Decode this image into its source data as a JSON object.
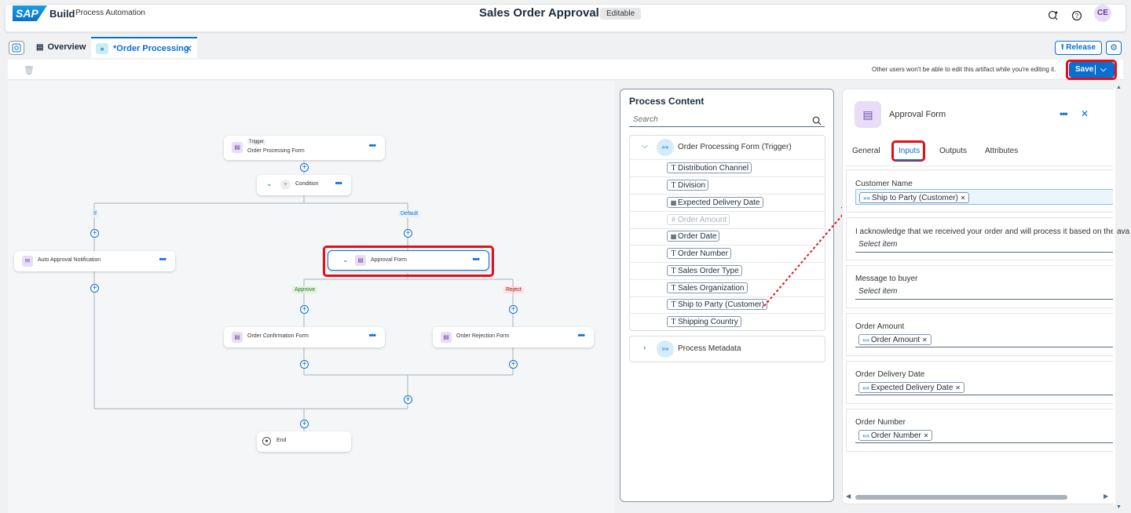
{
  "shell": {
    "logo": "SAP",
    "brand": "Build",
    "product": "Process Automation",
    "title": "Sales Order Approval",
    "status": "Editable",
    "avatar": "CE"
  },
  "tabs": {
    "overview": "Overview",
    "active": "*Order Processing",
    "release": "Release"
  },
  "toolbar": {
    "info": "Other users won't be able to edit this artifact while you're editing it.",
    "save": "Save"
  },
  "flow": {
    "trigger_tag": "Trigger",
    "trigger": "Order Processing Form",
    "condition": "Condition",
    "if_label": "If",
    "default_label": "Default",
    "auto_approval": "Auto Approval Notification",
    "approval_form": "Approval Form",
    "approve_label": "Approve",
    "reject_label": "Reject",
    "confirmation": "Order Confirmation Form",
    "rejection": "Order Rejection Form",
    "end": "End"
  },
  "process_content": {
    "title": "Process Content",
    "search_placeholder": "Search",
    "group1": "Order Processing Form (Trigger)",
    "fields": [
      {
        "label": "Distribution Channel",
        "type": "T"
      },
      {
        "label": "Division",
        "type": "T"
      },
      {
        "label": "Expected Delivery Date",
        "type": "date"
      },
      {
        "label": "Order Amount",
        "type": "#"
      },
      {
        "label": "Order Date",
        "type": "date"
      },
      {
        "label": "Order Number",
        "type": "T"
      },
      {
        "label": "Sales Order Type",
        "type": "T"
      },
      {
        "label": "Sales Organization",
        "type": "T"
      },
      {
        "label": "Ship to Party (Customer)",
        "type": "T"
      },
      {
        "label": "Shipping Country",
        "type": "T"
      }
    ],
    "group2": "Process Metadata"
  },
  "details": {
    "title": "Approval Form",
    "tabs": [
      "General",
      "Inputs",
      "Outputs",
      "Attributes"
    ],
    "active_tab": "Inputs",
    "inputs": [
      {
        "label": "Customer Name",
        "token": "Ship to Party (Customer)"
      },
      {
        "label": "I acknowledge that we received your order and will process it based on the ava",
        "placeholder": "Select item"
      },
      {
        "label": "Message to buyer",
        "placeholder": "Select item"
      },
      {
        "label": "Order Amount",
        "token": "Order Amount"
      },
      {
        "label": "Order Delivery Date",
        "token": "Expected Delivery Date"
      },
      {
        "label": "Order Number",
        "token": "Order Number"
      }
    ]
  },
  "colors": {
    "accent": "#0a6ed1",
    "highlight": "#e0101b",
    "form_icon_bg": "#e8dcf6",
    "approve_bg": "#e3f5d8",
    "reject_bg": "#fde2e6"
  }
}
